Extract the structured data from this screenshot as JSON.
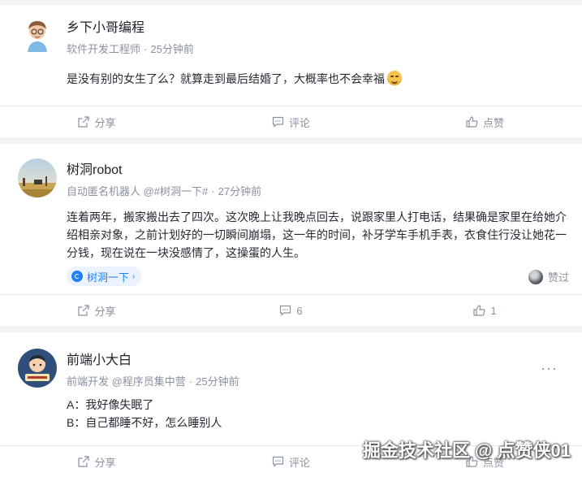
{
  "posts": [
    {
      "author": "乡下小哥编程",
      "subtitle": "软件开发工程师",
      "time": "25分钟前",
      "content": "是没有别的女生了么？就算走到最后结婚了，大概率也不会幸福",
      "actions": {
        "share": "分享",
        "comment": "评论",
        "like": "点赞"
      }
    },
    {
      "author": "树洞robot",
      "subtitle": "自动匿名机器人 @#树洞一下#",
      "time": "27分钟前",
      "content": "连着两年，搬家搬出去了四次。这次晚上让我晚点回去，说跟家里人打电话，结果确是家里在给她介绍相亲对象，之前计划好的一切瞬间崩塌，这一年的时间，补牙学车手机手表，衣食住行没让她花一分钱，现在说在一块没感情了，这操蛋的人生。",
      "tag": "树洞一下",
      "tag_chevron": "›",
      "liked_label": "赞过",
      "actions": {
        "share": "分享",
        "comment": "6",
        "like": "1"
      }
    },
    {
      "author": "前端小大白",
      "subtitle": "前端开发 @程序员集中营",
      "time": "25分钟前",
      "more": "···",
      "lines": [
        "A：我好像失眠了",
        "B：自己都睡不好，怎么睡别人"
      ],
      "actions": {
        "share": "分享",
        "comment": "评论",
        "like": "点赞"
      }
    }
  ],
  "separator_dot": "·",
  "watermark": "掘金技术社区 @ 点赞侠01",
  "colors": {
    "accent": "#1e80ff",
    "muted": "#8a919f",
    "background": "#f2f3f5"
  }
}
